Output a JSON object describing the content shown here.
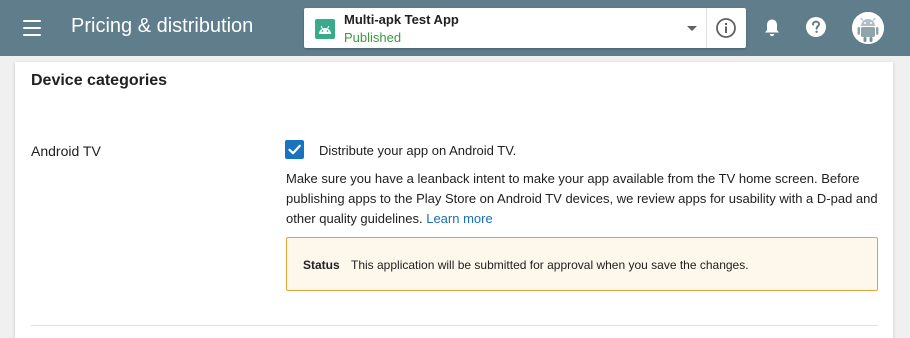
{
  "header": {
    "page_title": "Pricing & distribution",
    "app_selector": {
      "app_name": "Multi-apk Test App",
      "app_status": "Published"
    },
    "icons": [
      "menu-icon",
      "android-app-icon",
      "chevron-down-icon",
      "info-icon",
      "bell-icon",
      "help-icon",
      "avatar"
    ]
  },
  "card": {
    "section_title": "Device categories",
    "row": {
      "label": "Android TV",
      "checkbox": {
        "checked": true,
        "label": "Distribute your app on Android TV."
      },
      "description": "Make sure you have a leanback intent to make your app available from the TV home screen. Before publishing apps to the Play Store on Android TV devices, we review apps for usability with a D-pad and other quality guidelines.",
      "learn_more": "Learn more",
      "status": {
        "key": "Status",
        "text": "This application will be submitted for approval when you save the changes."
      }
    }
  },
  "colors": {
    "topbar": "#607d8b",
    "checkbox": "#1a73c0",
    "published": "#3d9a3f",
    "status_border": "#e6a23c",
    "status_bg": "#fef8ec",
    "link": "#1a6fb5"
  }
}
